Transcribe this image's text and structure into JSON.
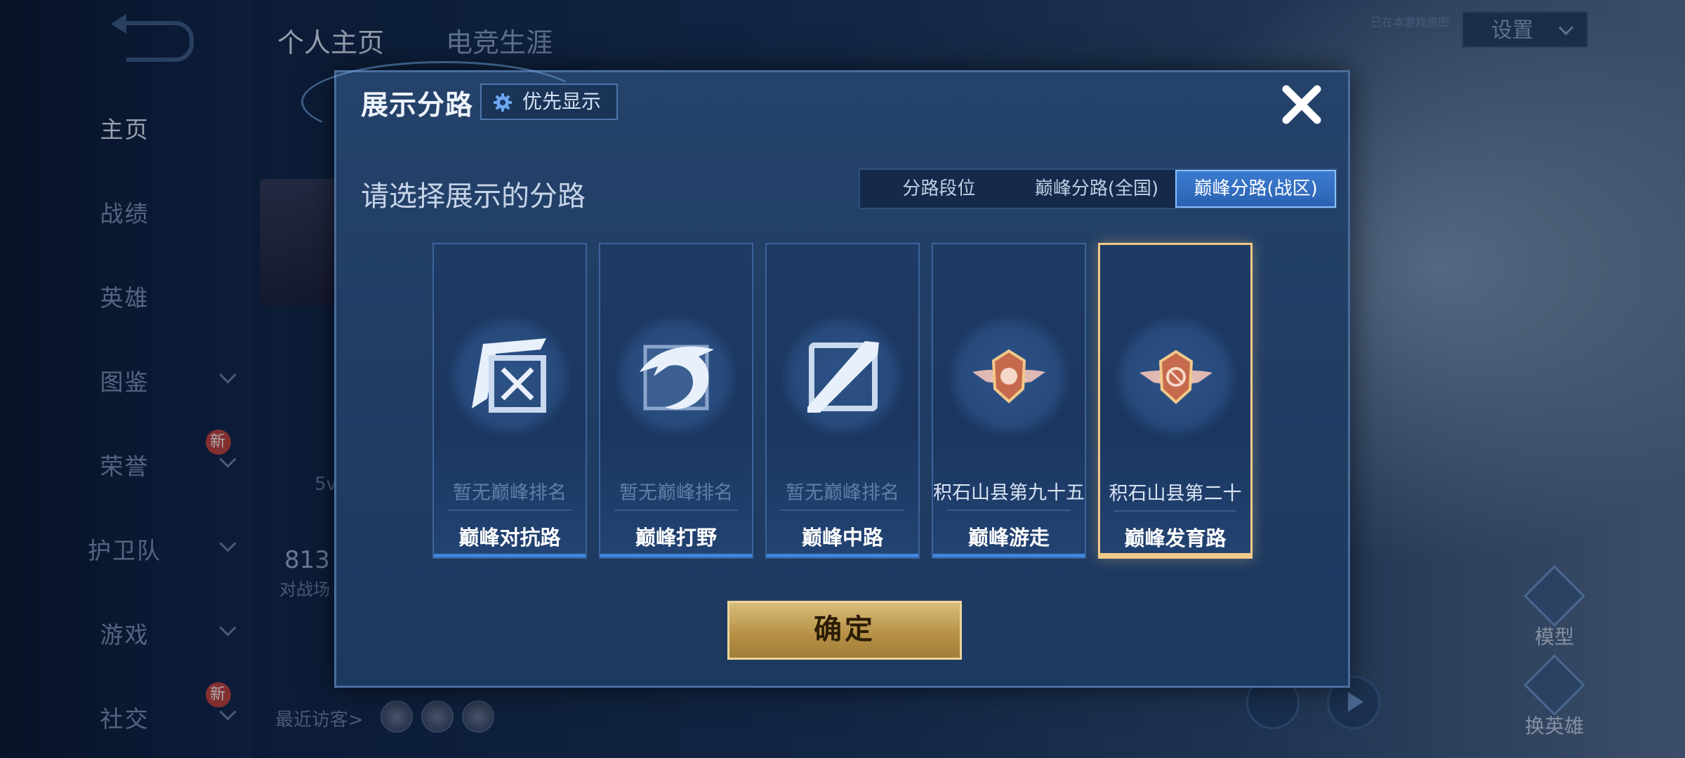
{
  "background": {
    "sidebar": {
      "items": [
        {
          "label": "主页",
          "active": true,
          "chevron": false,
          "new": false
        },
        {
          "label": "战绩",
          "active": false,
          "chevron": false,
          "new": false
        },
        {
          "label": "英雄",
          "active": false,
          "chevron": false,
          "new": false
        },
        {
          "label": "图鉴",
          "active": false,
          "chevron": true,
          "new": false
        },
        {
          "label": "荣誉",
          "active": false,
          "chevron": true,
          "new": true
        },
        {
          "label": "护卫队",
          "active": false,
          "chevron": true,
          "new": false
        },
        {
          "label": "游戏",
          "active": false,
          "chevron": true,
          "new": false
        },
        {
          "label": "社交",
          "active": false,
          "chevron": true,
          "new": true
        }
      ],
      "new_badge": "新"
    },
    "top_tabs": [
      "个人主页",
      "电竞生涯"
    ],
    "settings_label": "设置",
    "tiny_tag": "已在本游戏资密",
    "stat_number": "813",
    "stat_sub": "对战场",
    "level_text": "5v",
    "recent_visitors_label": "最近访客>",
    "right_buttons": {
      "model": "模型",
      "change_hero": "换英雄"
    }
  },
  "modal": {
    "title": "展示分路",
    "priority_button": "优先显示",
    "subtitle": "请选择展示的分路",
    "tabs": [
      {
        "label": "分路段位",
        "active": false
      },
      {
        "label": "巅峰分路(全国)",
        "active": false
      },
      {
        "label": "巅峰分路(战区)",
        "active": true
      }
    ],
    "cards": [
      {
        "emblem": "clash-lane-emblem-icon",
        "rank": "暂无巅峰排名",
        "lane": "巅峰对抗路",
        "has_rank": false,
        "selected": false
      },
      {
        "emblem": "jungle-dragon-emblem-icon",
        "rank": "暂无巅峰排名",
        "lane": "巅峰打野",
        "has_rank": false,
        "selected": false
      },
      {
        "emblem": "mid-lane-emblem-icon",
        "rank": "暂无巅峰排名",
        "lane": "巅峰中路",
        "has_rank": false,
        "selected": false
      },
      {
        "emblem": "roam-winged-badge-icon",
        "rank": "积石山县第九十五",
        "lane": "巅峰游走",
        "has_rank": true,
        "selected": false
      },
      {
        "emblem": "farm-winged-badge-icon",
        "rank": "积石山县第二十",
        "lane": "巅峰发育路",
        "has_rank": true,
        "selected": true
      }
    ],
    "confirm_label": "确定"
  },
  "colors": {
    "accent_gold": "#f2c989",
    "active_tab": "#3c7bd0",
    "modal_bg": "#23406a"
  }
}
